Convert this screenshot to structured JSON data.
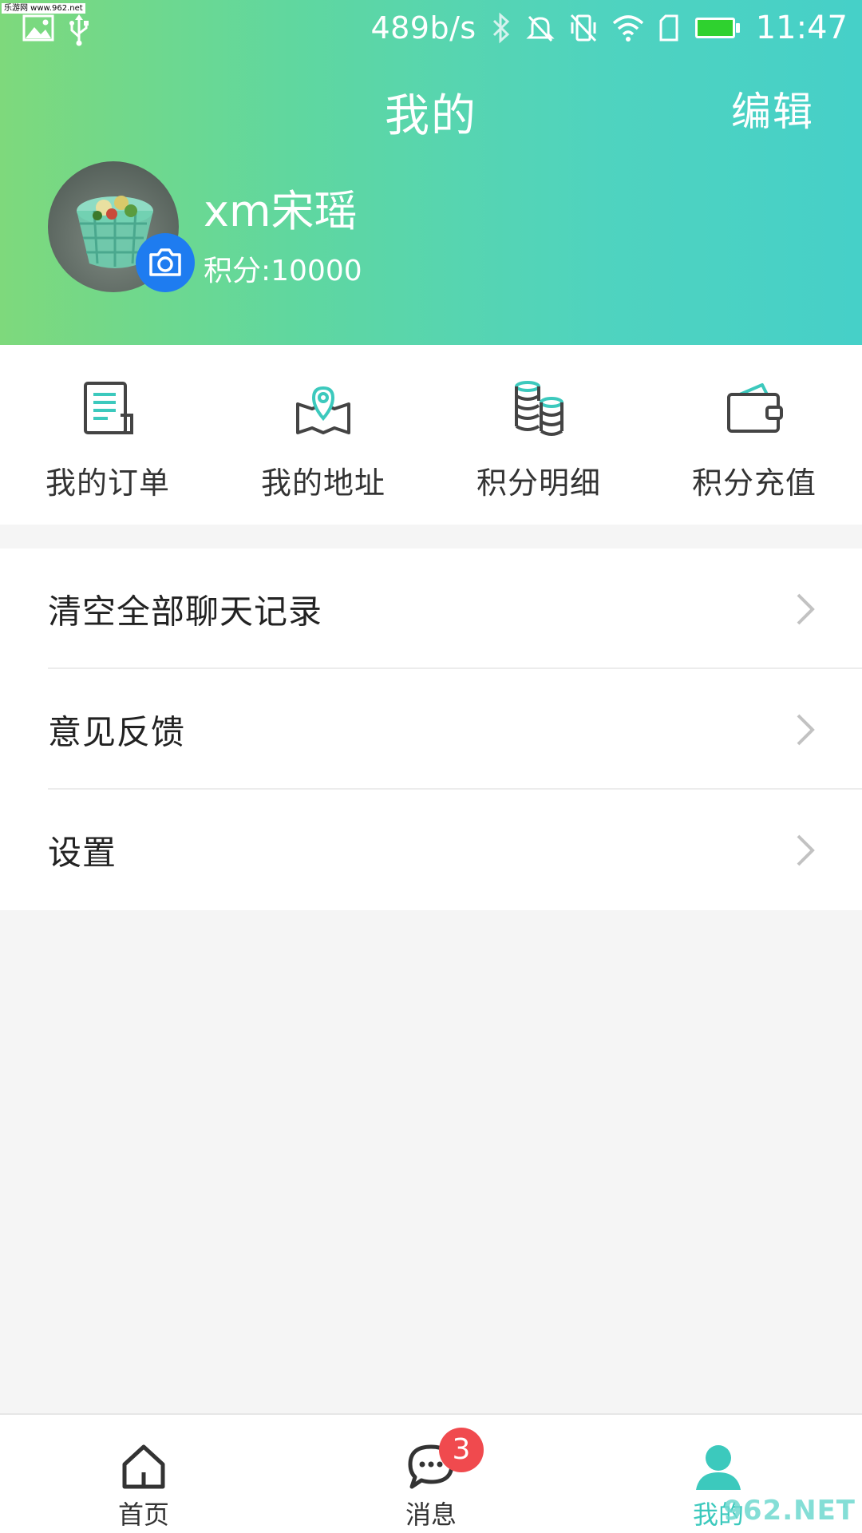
{
  "statusbar": {
    "watermark": "乐游网 www.962.net",
    "net_speed": "489b/s",
    "time": "11:47",
    "battery_color": "#2fd12f"
  },
  "header": {
    "title": "我的",
    "edit_label": "编辑"
  },
  "profile": {
    "username": "xm宋瑶",
    "points_text": "积分:10000",
    "camera_color": "#1e7cf0"
  },
  "quick_actions": [
    {
      "label": "我的订单",
      "icon": "order-list-icon"
    },
    {
      "label": "我的地址",
      "icon": "map-location-icon"
    },
    {
      "label": "积分明细",
      "icon": "coins-stack-icon"
    },
    {
      "label": "积分充值",
      "icon": "wallet-icon"
    }
  ],
  "menu": [
    {
      "label": "清空全部聊天记录"
    },
    {
      "label": "意见反馈"
    },
    {
      "label": "设置"
    }
  ],
  "tabbar": {
    "tabs": [
      {
        "label": "首页",
        "icon": "home-icon"
      },
      {
        "label": "消息",
        "icon": "chat-bubble-icon"
      },
      {
        "label": "我的",
        "icon": "user-icon",
        "active": true
      }
    ],
    "message_badge": "3",
    "active_color": "#3cc9bd"
  },
  "brand_watermark": "962.NET"
}
